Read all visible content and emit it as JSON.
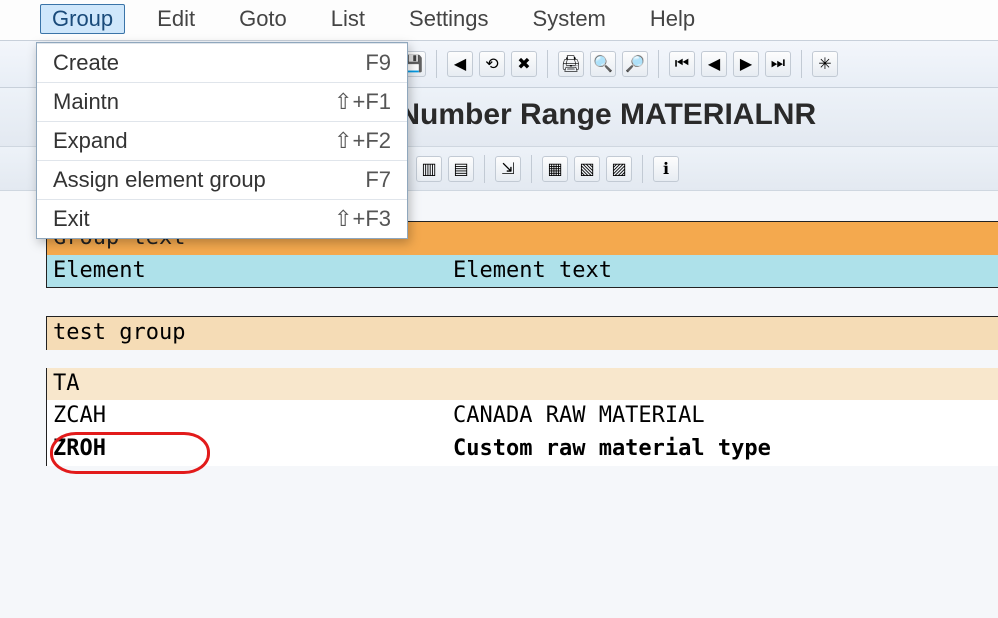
{
  "menubar": {
    "items": [
      {
        "label": "Group",
        "active": true
      },
      {
        "label": "Edit"
      },
      {
        "label": "Goto"
      },
      {
        "label": "List"
      },
      {
        "label": "Settings"
      },
      {
        "label": "System"
      },
      {
        "label": "Help"
      }
    ]
  },
  "dropdown": {
    "items": [
      {
        "label": "Create",
        "shortcut": "F9"
      },
      {
        "label": "Maintn",
        "shortcut": "⇧+F1"
      },
      {
        "label": "Expand",
        "shortcut": "⇧+F2"
      },
      {
        "label": "Assign element group",
        "shortcut": "F7"
      },
      {
        "label": "Exit",
        "shortcut": "⇧+F3"
      }
    ]
  },
  "title": ": Number Range MATERIALNR",
  "header_block": {
    "row1_label": "Group text",
    "row2_c1": "Element",
    "row2_c2": "Element text"
  },
  "group_block": {
    "group_name": "test group"
  },
  "rows": [
    {
      "c1": "TA",
      "c2": "",
      "style": "tan-light"
    },
    {
      "c1": "ZCAH",
      "c2": "CANADA RAW MATERIAL",
      "style": "white"
    },
    {
      "c1": "ZROH",
      "c2": "Custom raw material type",
      "style": "white bold"
    }
  ]
}
